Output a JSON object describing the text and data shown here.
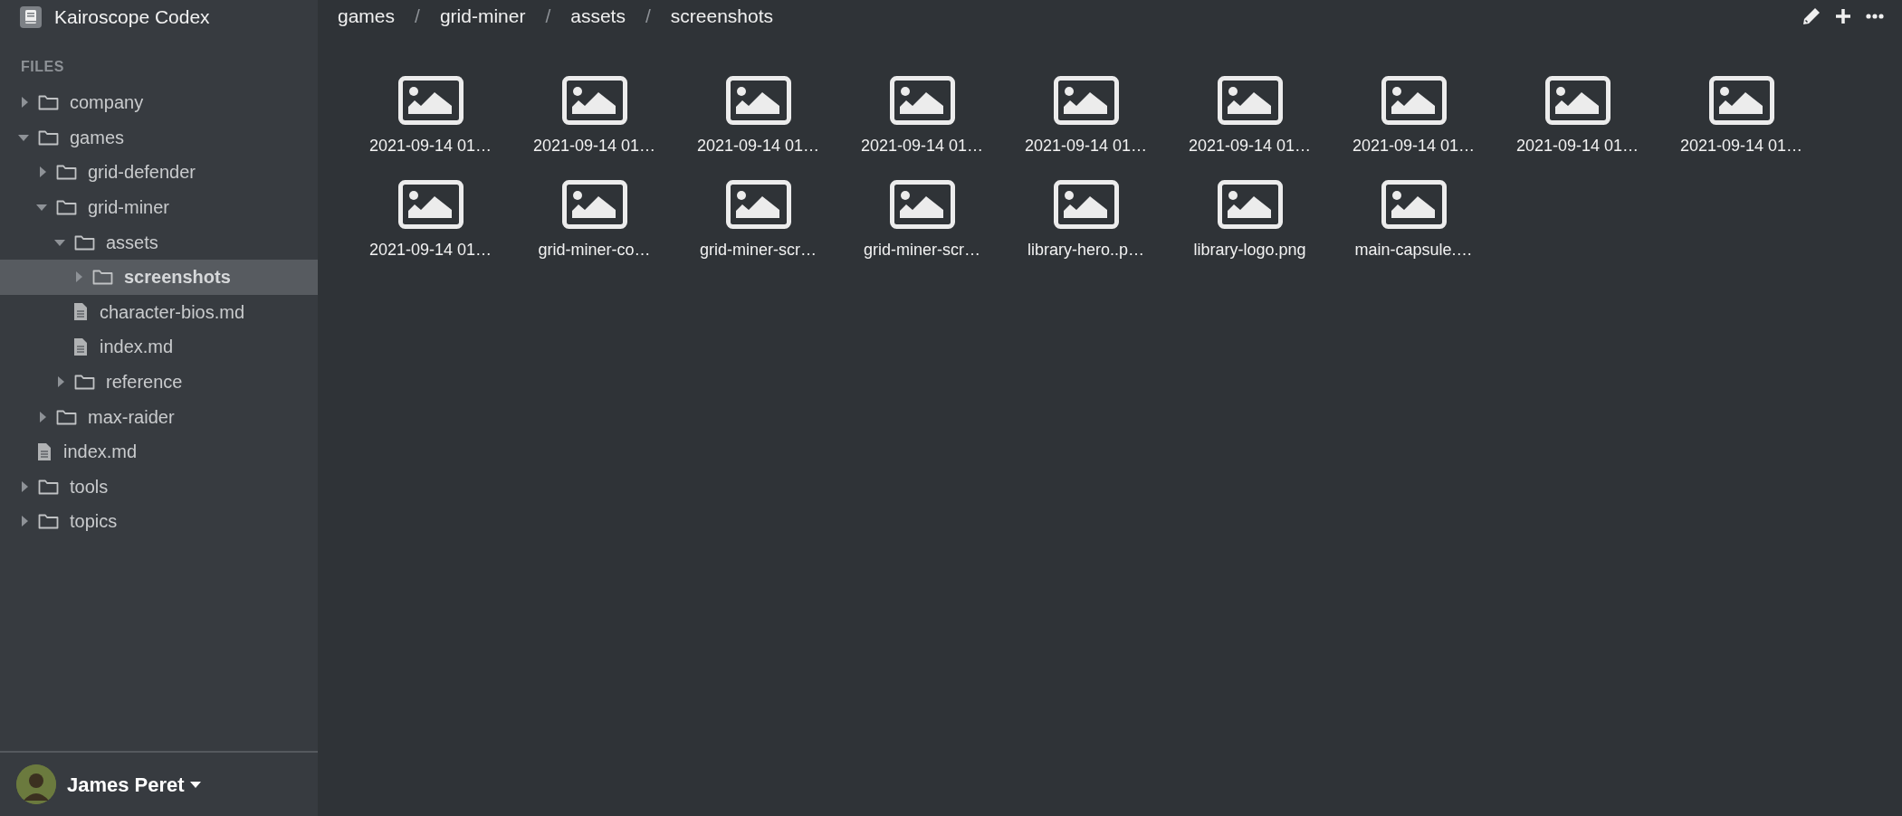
{
  "app": {
    "title": "Kairoscope Codex"
  },
  "sidebar": {
    "section_label": "FILES",
    "tree": [
      {
        "label": "company",
        "kind": "folder",
        "expanded": false,
        "selected": false
      },
      {
        "label": "games",
        "kind": "folder",
        "expanded": true,
        "selected": false,
        "children": [
          {
            "label": "grid-defender",
            "kind": "folder",
            "expanded": false,
            "selected": false
          },
          {
            "label": "grid-miner",
            "kind": "folder",
            "expanded": true,
            "selected": false,
            "children": [
              {
                "label": "assets",
                "kind": "folder",
                "expanded": true,
                "selected": false,
                "children": [
                  {
                    "label": "screenshots",
                    "kind": "folder",
                    "expanded": false,
                    "selected": true
                  },
                  {
                    "label": "character-bios.md",
                    "kind": "file",
                    "selected": false
                  },
                  {
                    "label": "index.md",
                    "kind": "file",
                    "selected": false
                  }
                ]
              },
              {
                "label": "reference",
                "kind": "folder",
                "expanded": false,
                "selected": false
              }
            ]
          },
          {
            "label": "max-raider",
            "kind": "folder",
            "expanded": false,
            "selected": false
          },
          {
            "label": "index.md",
            "kind": "file",
            "selected": false
          }
        ]
      },
      {
        "label": "tools",
        "kind": "folder",
        "expanded": false,
        "selected": false
      },
      {
        "label": "topics",
        "kind": "folder",
        "expanded": false,
        "selected": false
      }
    ],
    "user": {
      "name": "James Peret"
    }
  },
  "breadcrumb": [
    {
      "kind": "crumb",
      "text": "games"
    },
    {
      "kind": "separator",
      "text": "/"
    },
    {
      "kind": "crumb",
      "text": "grid-miner"
    },
    {
      "kind": "separator",
      "text": "/"
    },
    {
      "kind": "crumb",
      "text": "assets"
    },
    {
      "kind": "separator",
      "text": "/"
    },
    {
      "kind": "crumb",
      "text": "screenshots"
    }
  ],
  "files": [
    {
      "name": "2021-09-14 01…"
    },
    {
      "name": "2021-09-14 01…"
    },
    {
      "name": "2021-09-14 01…"
    },
    {
      "name": "2021-09-14 01…"
    },
    {
      "name": "2021-09-14 01…"
    },
    {
      "name": "2021-09-14 01…"
    },
    {
      "name": "2021-09-14 01…"
    },
    {
      "name": "2021-09-14 01…"
    },
    {
      "name": "2021-09-14 01…"
    },
    {
      "name": "2021-09-14 01…"
    },
    {
      "name": "grid-miner-co…"
    },
    {
      "name": "grid-miner-scr…"
    },
    {
      "name": "grid-miner-scr…"
    },
    {
      "name": "library-hero..p…"
    },
    {
      "name": "library-logo.png"
    },
    {
      "name": "main-capsule.…"
    }
  ]
}
